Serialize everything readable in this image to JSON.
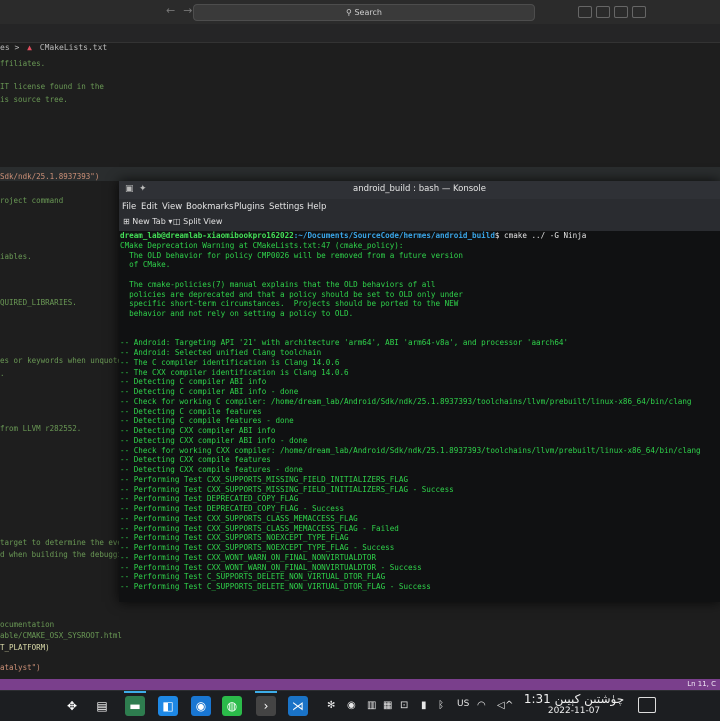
{
  "vscode": {
    "search_label": "Search",
    "breadcrumb": {
      "folder": "es",
      "sep": ">",
      "file": "CMakeLists.txt"
    },
    "lines": [
      {
        "text": "ffiliates.",
        "cls": "c-comment"
      },
      {
        "text": "IT license found in the",
        "cls": "c-comment"
      },
      {
        "text": "is source tree.",
        "cls": "c-comment"
      },
      {
        "text": "Sdk/ndk/25.1.8937393\")",
        "cls": "c-str"
      },
      {
        "text": "roject command",
        "cls": "c-comment"
      },
      {
        "text": "iables.",
        "cls": "c-comment"
      },
      {
        "text": "QUIRED_LIBRARIES.",
        "cls": "c-comment"
      },
      {
        "text": "es or keywords when unquoted",
        "cls": "c-comment"
      },
      {
        "text": ".",
        "cls": "c-comment"
      },
      {
        "text": " from LLVM r282552.",
        "cls": "c-comment"
      },
      {
        "text": " target to determine the eve",
        "cls": "c-comment"
      },
      {
        "text": "d when building the debuggin",
        "cls": "c-comment"
      },
      {
        "text": "ocumentation",
        "cls": "c-comment"
      },
      {
        "text": "able/CMAKE_OSX_SYSROOT.html",
        "cls": "c-comment"
      },
      {
        "text": "T_PLATFORM)",
        "cls": "c-fn"
      },
      {
        "text": "atalyst\")",
        "cls": "c-str"
      }
    ],
    "status_position": "Ln 11, C"
  },
  "konsole": {
    "title": "android_build : bash — Konsole",
    "menu": [
      "File",
      "Edit",
      "View",
      "Bookmarks",
      "Plugins",
      "Settings",
      "Help"
    ],
    "toolbar": {
      "new_tab": "New Tab",
      "split_view": "Split View"
    },
    "prompt": {
      "user_host": "dream_lab@dreamlab-xiaomibookpro162022",
      "path": ":~/Documents/SourceCode/hermes/android_build",
      "command": "$ cmake ../ -G Ninja"
    },
    "output": [
      "CMake Deprecation Warning at CMakeLists.txt:47 (cmake_policy):",
      "  The OLD behavior for policy CMP0026 will be removed from a future version",
      "  of CMake.",
      "",
      "  The cmake-policies(7) manual explains that the OLD behaviors of all",
      "  policies are deprecated and that a policy should be set to OLD only under",
      "  specific short-term circumstances.  Projects should be ported to the NEW",
      "  behavior and not rely on setting a policy to OLD.",
      "",
      "",
      "-- Android: Targeting API '21' with architecture 'arm64', ABI 'arm64-v8a', and processor 'aarch64'",
      "-- Android: Selected unified Clang toolchain",
      "-- The C compiler identification is Clang 14.0.6",
      "-- The CXX compiler identification is Clang 14.0.6",
      "-- Detecting C compiler ABI info",
      "-- Detecting C compiler ABI info - done",
      "-- Check for working C compiler: /home/dream_lab/Android/Sdk/ndk/25.1.8937393/toolchains/llvm/prebuilt/linux-x86_64/bin/clang",
      "-- Detecting C compile features",
      "-- Detecting C compile features - done",
      "-- Detecting CXX compiler ABI info",
      "-- Detecting CXX compiler ABI info - done",
      "-- Check for working CXX compiler: /home/dream_lab/Android/Sdk/ndk/25.1.8937393/toolchains/llvm/prebuilt/linux-x86_64/bin/clang",
      "-- Detecting CXX compile features",
      "-- Detecting CXX compile features - done",
      "-- Performing Test CXX_SUPPORTS_MISSING_FIELD_INITIALIZERS_FLAG",
      "-- Performing Test CXX_SUPPORTS_MISSING_FIELD_INITIALIZERS_FLAG - Success",
      "-- Performing Test DEPRECATED_COPY_FLAG",
      "-- Performing Test DEPRECATED_COPY_FLAG - Success",
      "-- Performing Test CXX_SUPPORTS_CLASS_MEMACCESS_FLAG",
      "-- Performing Test CXX_SUPPORTS_CLASS_MEMACCESS_FLAG - Failed",
      "-- Performing Test CXX_SUPPORTS_NOEXCEPT_TYPE_FLAG",
      "-- Performing Test CXX_SUPPORTS_NOEXCEPT_TYPE_FLAG - Success",
      "-- Performing Test CXX_WONT_WARN_ON_FINAL_NONVIRTUALDTOR",
      "-- Performing Test CXX_WONT_WARN_ON_FINAL_NONVIRTUALDTOR - Success",
      "-- Performing Test C_SUPPORTS_DELETE_NON_VIRTUAL_DTOR_FLAG",
      "-- Performing Test C_SUPPORTS_DELETE_NON_VIRTUAL_DTOR_FLAG - Success"
    ]
  },
  "taskbar": {
    "apps": [
      {
        "name": "app-launcher-icon",
        "glyph": "✥",
        "bg": "transparent"
      },
      {
        "name": "task-manager-icon",
        "glyph": "▤",
        "bg": "transparent"
      },
      {
        "name": "files-icon",
        "glyph": "▬",
        "bg": "#2e7d4f"
      },
      {
        "name": "store-icon",
        "glyph": "◧",
        "bg": "#1e88e5"
      },
      {
        "name": "edge-icon",
        "glyph": "◉",
        "bg": "#1976d2"
      },
      {
        "name": "wechat-icon",
        "glyph": "◍",
        "bg": "#2bbb4a"
      },
      {
        "name": "konsole-icon",
        "glyph": "›",
        "bg": "#444"
      },
      {
        "name": "vscode-icon",
        "glyph": "⋊",
        "bg": "#1a73c7"
      }
    ],
    "tray_language": "US",
    "clock_time": "1:31 چۈشتىن كېيىن",
    "clock_date": "2022-11-07"
  }
}
